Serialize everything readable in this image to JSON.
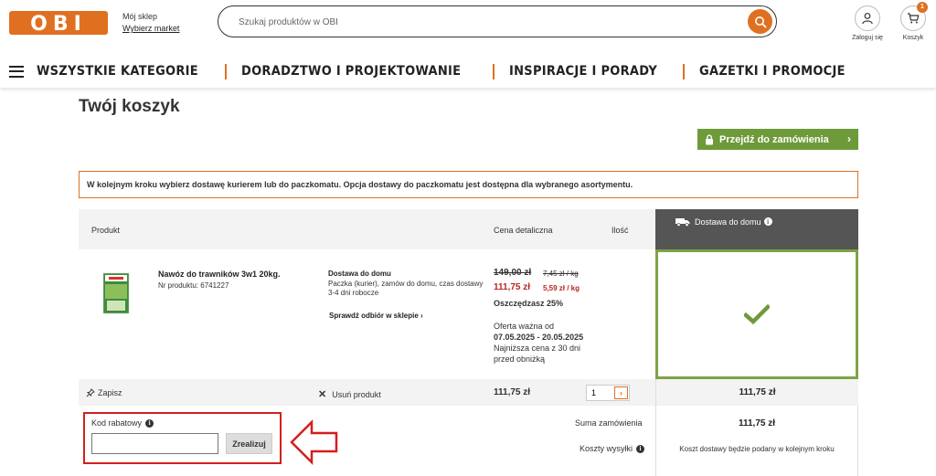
{
  "header": {
    "logo_text": "OBI",
    "my_store_label": "Mój sklep",
    "choose_market_link": "Wybierz market",
    "search": {
      "placeholder": "Szukaj produktów w OBI",
      "value": ""
    },
    "login_label": "Zaloguj się",
    "cart_label": "Koszyk",
    "cart_count": "1"
  },
  "nav": {
    "items": [
      "WSZYSTKIE KATEGORIE",
      "DORADZTWO I PROJEKTOWANIE",
      "INSPIRACJE I PORADY",
      "GAZETKI I PROMOCJE"
    ]
  },
  "page": {
    "title": "Twój koszyk",
    "checkout_button": "Przejdź do zamówienia",
    "notice": "W kolejnym kroku wybierz dostawę kurierem lub do paczkomatu. Opcja dostawy do paczkomatu jest dostępna dla wybranego asortymentu."
  },
  "table": {
    "headers": {
      "product": "Produkt",
      "price": "Cena detaliczna",
      "qty": "Ilość",
      "delivery": "Dostawa do domu"
    }
  },
  "item": {
    "name": "Nawóz do trawników 3w1 20kg.",
    "number": "Nr produktu: 6741227",
    "delivery_title": "Dostawa do domu",
    "delivery_desc": "Paczka (kurier), zamów do domu, czas dostawy 3-4 dni robocze",
    "check_store_link": "Sprawdź odbiór w sklepie",
    "old_price": "149,00 zł",
    "old_unit_price": "7,45 zł / kg",
    "new_price": "111,75 zł",
    "new_unit_price": "5,59 zł / kg",
    "savings": "Oszczędzasz 25%",
    "offer_valid_label": "Oferta ważna od",
    "offer_dates": "07.05.2025 - 20.05.2025",
    "lowest_price_note": "Najniższa cena z 30 dni przed obniżką",
    "save_action": "Zapisz",
    "remove_action": "Usuń produkt",
    "row_total": "111,75 zł",
    "quantity": "1",
    "delivery_total": "111,75 zł"
  },
  "summary": {
    "coupon_label": "Kod rabatowy",
    "coupon_value": "",
    "coupon_button": "Zrealizuj",
    "order_sum_label": "Suma zamówienia",
    "order_sum_value": "111,75 zł",
    "shipping_label": "Koszty wysyłki",
    "shipping_value": "Koszt dostawy będzie podany w kolejnym kroku"
  },
  "colors": {
    "brand_orange": "#e07021",
    "checkout_green": "#6e9a3a",
    "price_red": "#b7281f",
    "highlight_red": "#d21f1f"
  }
}
